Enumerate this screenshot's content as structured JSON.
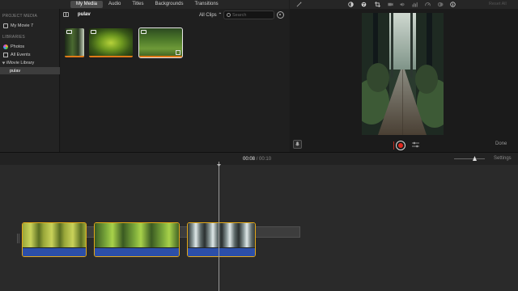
{
  "tabs": [
    "My Media",
    "Audio",
    "Titles",
    "Backgrounds",
    "Transitions"
  ],
  "sidebar": {
    "project_media_heading": "PROJECT MEDIA",
    "project_item": "My Movie 7",
    "libraries_heading": "LIBRARIES",
    "photos": "Photos",
    "all_events": "All Events",
    "library": "iMovie Library",
    "event": "pulav"
  },
  "browser": {
    "event_title": "pulav",
    "filter": "All Clips ⌃",
    "search_placeholder": "Search"
  },
  "viewer": {
    "reset_all": "Reset All",
    "done": "Done"
  },
  "timeline": {
    "current_time": "00:08",
    "separator": "/",
    "total_time": "00:10",
    "settings": "Settings"
  },
  "colors": {
    "accent_orange": "#e07a18",
    "clip_border": "#e3a81a",
    "audio_blue": "#2d4fa8",
    "record_red": "#e0281e"
  },
  "icons": [
    "sidebar-toggle-icon",
    "search-icon",
    "gear-icon",
    "magic-wand-icon",
    "color-balance-icon",
    "color-palette-icon",
    "crop-icon",
    "camera-icon",
    "volume-icon",
    "equalizer-icon",
    "speed-icon",
    "filter-icon",
    "info-icon",
    "microphone-icon",
    "record-icon",
    "adjust-icon"
  ]
}
